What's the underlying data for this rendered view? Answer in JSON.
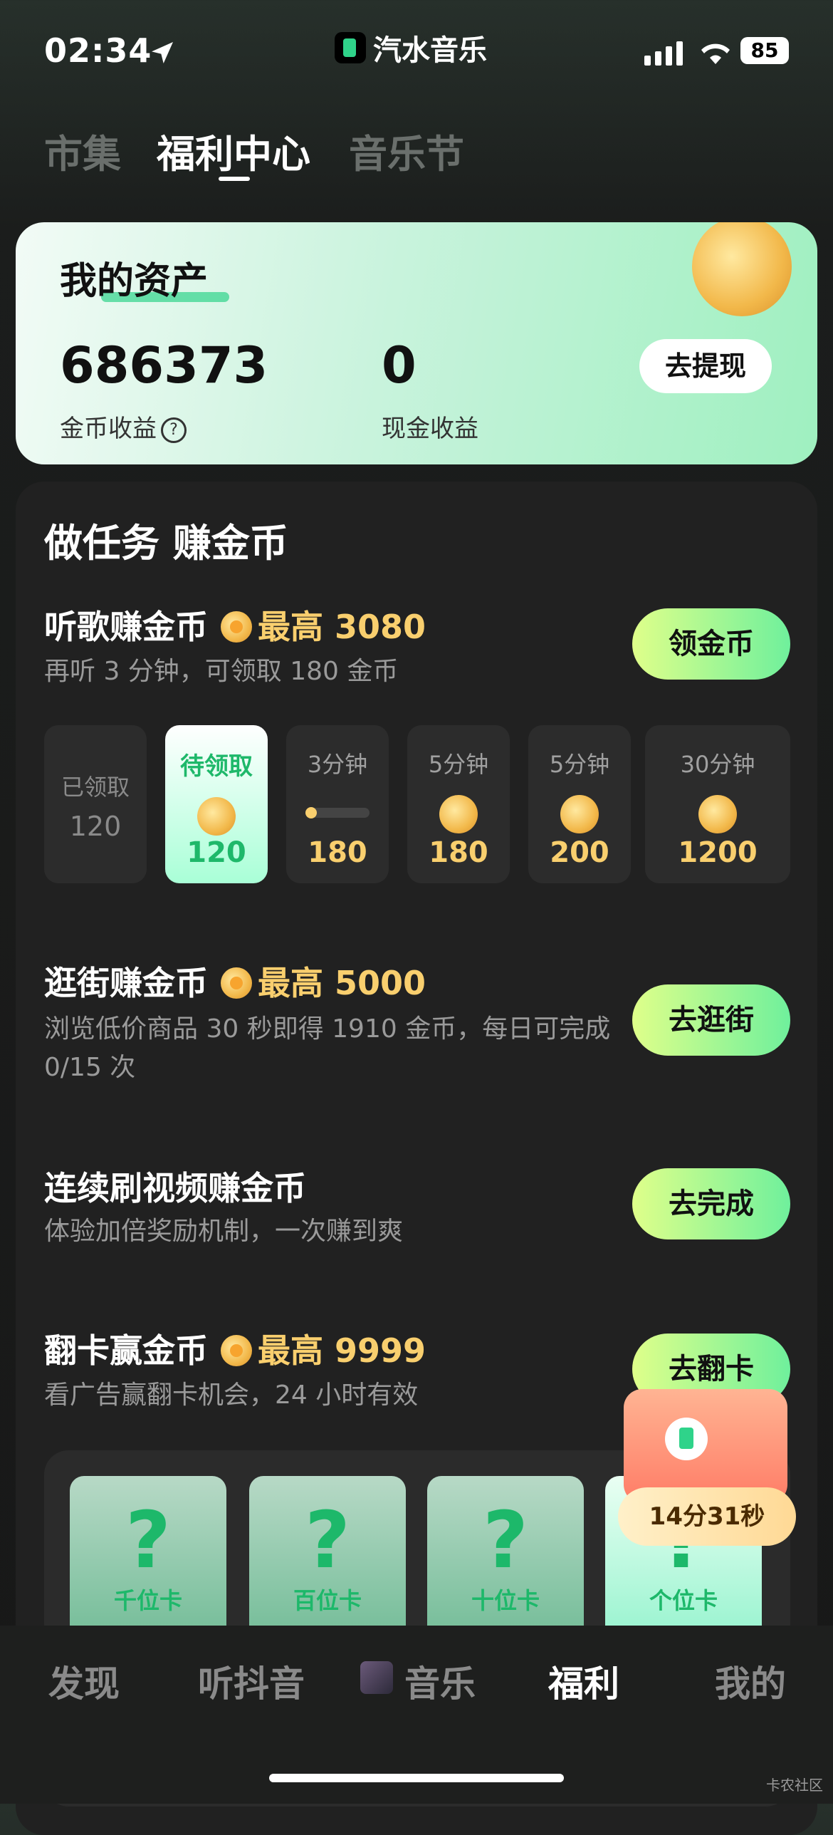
{
  "status": {
    "time": "02:34",
    "battery": "85"
  },
  "brand": {
    "name": "汽水音乐"
  },
  "tabs": [
    "市集",
    "福利中心",
    "音乐节"
  ],
  "assets": {
    "title": "我的资产",
    "coins_value": "686373",
    "coins_label": "金币收益",
    "cash_value": "0",
    "cash_label": "现金收益",
    "withdraw_label": "去提现"
  },
  "tasks_title": "做任务 赚金币",
  "tasks": [
    {
      "title": "听歌赚金币",
      "max": "最高 3080",
      "desc": "再听 3 分钟，可领取 180 金币",
      "button": "领金币"
    },
    {
      "title": "逛街赚金币",
      "max": "最高 5000",
      "desc": "浏览低价商品 30 秒即得 1910 金币，每日可完成 0/15 次",
      "button": "去逛街"
    },
    {
      "title": "连续刷视频赚金币",
      "max": "",
      "desc": "体验加倍奖励机制，一次赚到爽",
      "button": "去完成"
    },
    {
      "title": "翻卡赢金币",
      "max": "最高 9999",
      "desc": "看广告赢翻卡机会，24 小时有效",
      "button": "去翻卡"
    }
  ],
  "timeline": [
    {
      "label": "已领取",
      "value": "120"
    },
    {
      "label": "待领取",
      "value": "120"
    },
    {
      "label": "3分钟",
      "value": "180"
    },
    {
      "label": "5分钟",
      "value": "180"
    },
    {
      "label": "5分钟",
      "value": "200"
    },
    {
      "label": "30分钟",
      "value": "1200"
    }
  ],
  "flip_cards": [
    "千位卡",
    "百位卡",
    "十位卡",
    "个位卡"
  ],
  "treasure": {
    "timer": "14分31秒"
  },
  "bottom_nav": [
    "发现",
    "听抖音",
    "音乐",
    "福利",
    "我的"
  ],
  "watermark": "卡农社区",
  "colors": {
    "accent_green": "#2fd38a",
    "gold": "#f9cf6e"
  }
}
